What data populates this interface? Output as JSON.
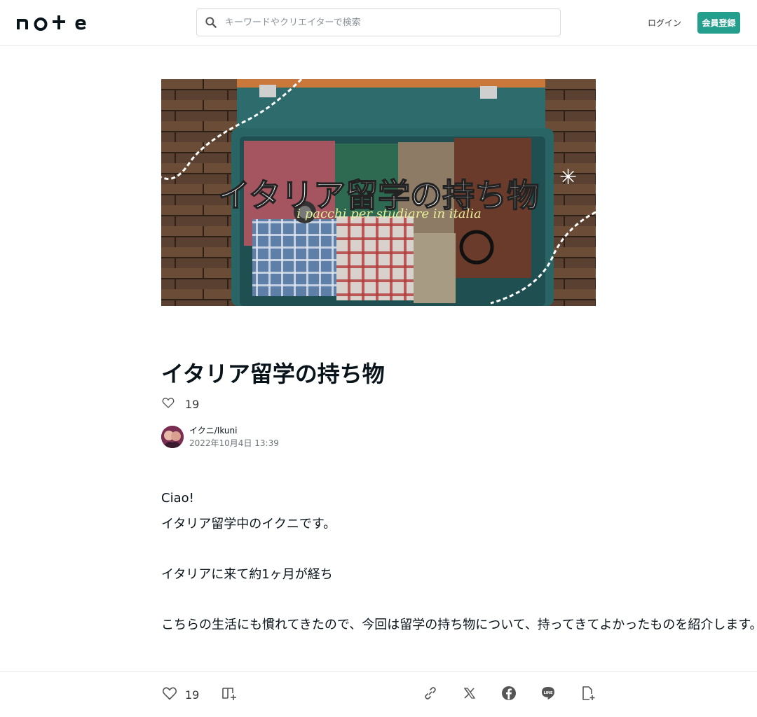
{
  "header": {
    "logo_text": "note",
    "search_placeholder": "キーワードやクリエイターで検索",
    "login_label": "ログイン",
    "signup_label": "会員登録"
  },
  "hero": {
    "title_overlay": "イタリア留学の持ち物",
    "subtitle_overlay": "i pacchi per studiare in italia"
  },
  "article": {
    "title": "イタリア留学の持ち物",
    "like_count": "19",
    "author_name": "イクニ/Ikuni",
    "published": "2022年10月4日 13:39",
    "paragraphs": [
      "Ciao!",
      "イタリア留学中のイクニです。",
      "イタリアに来て約1ヶ月が経ち",
      "こちらの生活にも慣れてきたので、今回は留学の持ち物について、持ってきてよかったものを紹介します。"
    ]
  },
  "bottom_bar": {
    "like_count": "19"
  },
  "colors": {
    "brand_green": "#249f8d",
    "text": "#08131a"
  }
}
